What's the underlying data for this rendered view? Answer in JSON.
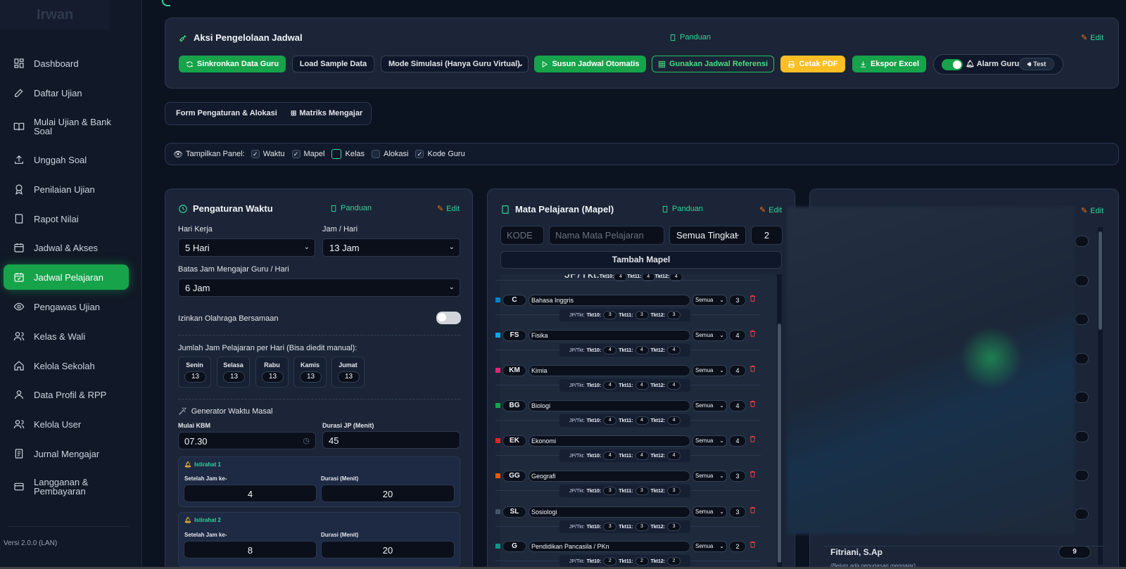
{
  "sidebar": {
    "logo": "Irwan",
    "items": [
      {
        "label": "Dashboard",
        "icon": "dashboard-icon"
      },
      {
        "label": "Daftar Ujian",
        "icon": "pencil-icon"
      },
      {
        "label": "Mulai Ujian & Bank Soal",
        "icon": "book-open-icon"
      },
      {
        "label": "Unggah Soal",
        "icon": "upload-icon"
      },
      {
        "label": "Penilaian Ujian",
        "icon": "award-icon"
      },
      {
        "label": "Rapot Nilai",
        "icon": "book-icon"
      },
      {
        "label": "Jadwal & Akses",
        "icon": "calendar-icon"
      },
      {
        "label": "Jadwal Pelajaran",
        "icon": "calendar-check-icon"
      },
      {
        "label": "Pengawas Ujian",
        "icon": "eye-icon"
      },
      {
        "label": "Kelas & Wali",
        "icon": "users-icon"
      },
      {
        "label": "Kelola Sekolah",
        "icon": "home-icon"
      },
      {
        "label": "Data Profil & RPP",
        "icon": "user-icon"
      },
      {
        "label": "Kelola User",
        "icon": "users-icon"
      },
      {
        "label": "Jurnal Mengajar",
        "icon": "journal-icon"
      },
      {
        "label": "Langganan & Pembayaran",
        "icon": "credit-card-icon"
      }
    ],
    "active": "Jadwal Pelajaran",
    "version": "Versi 2.0.0 (LAN)"
  },
  "actions": {
    "title": "Aksi Pengelolaan Jadwal",
    "guide": "Panduan",
    "edit": "Edit",
    "sync": "Sinkronkan Data Guru",
    "load_sample": "Load Sample Data",
    "mode_select": "Mode Simulasi (Hanya Guru Virtual)",
    "auto": "Susun Jadwal Otomatis",
    "reference": "Gunakan Jadwal Referensi",
    "pdf": "Cetak PDF",
    "excel": "Ekspor Excel",
    "alarm": "Alarm Guru",
    "test": "Test"
  },
  "tabs": [
    "Form Pengaturan & Alokasi",
    "Matriks Mengajar"
  ],
  "panel_toggle": {
    "label": "Tampilkan Panel:",
    "options": [
      {
        "label": "Waktu",
        "checked": true
      },
      {
        "label": "Mapel",
        "checked": true
      },
      {
        "label": "Kelas",
        "checked": false
      },
      {
        "label": "Alokasi",
        "checked": false
      },
      {
        "label": "Kode Guru",
        "checked": true
      }
    ]
  },
  "waktu": {
    "title": "Pengaturan Waktu",
    "guide": "Panduan",
    "edit": "Edit",
    "hari_kerja_label": "Hari Kerja",
    "hari_kerja": "5 Hari",
    "jam_hari_label": "Jam / Hari",
    "jam_hari": "13 Jam",
    "batas_label": "Batas Jam Mengajar Guru / Hari",
    "batas": "6 Jam",
    "olahraga_label": "Izinkan Olahraga Bersamaan",
    "olahraga_on": false,
    "jumlah_label": "Jumlah Jam Pelajaran per Hari (Bisa diedit manual):",
    "days": [
      {
        "name": "Senin",
        "value": "13"
      },
      {
        "name": "Selasa",
        "value": "13"
      },
      {
        "name": "Rabu",
        "value": "13"
      },
      {
        "name": "Kamis",
        "value": "13"
      },
      {
        "name": "Jumat",
        "value": "13"
      }
    ],
    "generator_label": "Generator Waktu Masal",
    "mulai_label": "Mulai KBM",
    "mulai": "07.30",
    "durasi_label": "Durasi JP (Menit)",
    "durasi": "45",
    "breaks": [
      {
        "title": "Istirahat 1",
        "after_label": "Setelah Jam ke-",
        "after": "4",
        "dur_label": "Durasi (Menit)",
        "dur": "20"
      },
      {
        "title": "Istirahat 2",
        "after_label": "Setelah Jam ke-",
        "after": "8",
        "dur_label": "Durasi (Menit)",
        "dur": "20"
      }
    ]
  },
  "mapel": {
    "title": "Mata Pelajaran (Mapel)",
    "guide": "Panduan",
    "edit": "Edit",
    "kode_placeholder": "KODE",
    "nama_placeholder": "Nama Mata Pelajaran",
    "tingkat": "Semua Tingkat",
    "jp": "2",
    "add": "Tambah Mapel",
    "jp_label": "JP/Tkt:",
    "t10": "Tkt10:",
    "t11": "Tkt11:",
    "t12": "Tkt12:",
    "partial": {
      "t10": "4",
      "t11": "4",
      "t12": "4"
    },
    "rows": [
      {
        "code": "C",
        "name": "Bahasa Inggris",
        "tingkat": "Semua",
        "jp": "3",
        "t10": "3",
        "t11": "3",
        "t12": "3",
        "color": "#0284c7"
      },
      {
        "code": "FS",
        "name": "Fisika",
        "tingkat": "Semua",
        "jp": "4",
        "t10": "4",
        "t11": "4",
        "t12": "4",
        "color": "#0ea5e9"
      },
      {
        "code": "KM",
        "name": "Kimia",
        "tingkat": "Semua",
        "jp": "4",
        "t10": "4",
        "t11": "4",
        "t12": "4",
        "color": "#db2777"
      },
      {
        "code": "BG",
        "name": "Biologi",
        "tingkat": "Semua",
        "jp": "4",
        "t10": "4",
        "t11": "4",
        "t12": "4",
        "color": "#16a34a"
      },
      {
        "code": "EK",
        "name": "Ekonomi",
        "tingkat": "Semua",
        "jp": "4",
        "t10": "4",
        "t11": "4",
        "t12": "4",
        "color": "#dc2626"
      },
      {
        "code": "GG",
        "name": "Geografi",
        "tingkat": "Semua",
        "jp": "3",
        "t10": "3",
        "t11": "3",
        "t12": "3",
        "color": "#ea580c"
      },
      {
        "code": "SL",
        "name": "Sosiologi",
        "tingkat": "Semua",
        "jp": "3",
        "t10": "3",
        "t11": "3",
        "t12": "3",
        "color": "#475569"
      },
      {
        "code": "G",
        "name": "Pendidikan Pancasila / PKn",
        "tingkat": "Semua",
        "jp": "2",
        "t10": "2",
        "t11": "2",
        "t12": "2",
        "color": "#0d9488"
      }
    ]
  },
  "guru": {
    "edit": "Edit",
    "last_name": "Fitriani, S.Ap",
    "last_count": "9",
    "last_note": "(Belum ada penugasan mengajar)"
  },
  "colors": {
    "accent": "#16a34a",
    "warn": "#fbbf24",
    "danger": "#ef4444"
  }
}
